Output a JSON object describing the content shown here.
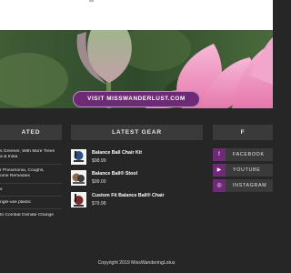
{
  "hero": {
    "button_label": "VISIT MISSWANDERLUST.COM"
  },
  "related": {
    "heading": "ATED",
    "items": [
      "s Greener, With More Trees",
      "a & India",
      "r Pneumonia, Coughs,",
      "ome Remedies",
      "s",
      "ngle-use plastic",
      "to Combat Climate Change"
    ]
  },
  "latest_gear": {
    "heading": "LATEST GEAR",
    "items": [
      {
        "name": "Balance Ball Chair Kit",
        "price": "$98.99"
      },
      {
        "name": "Balance Ball® Stool",
        "price": "$99.00"
      },
      {
        "name": "Custom Fit Balance Ball® Chair",
        "price": "$79.98"
      }
    ]
  },
  "social": {
    "heading": "F",
    "links": [
      {
        "label": "FACEBOOK",
        "icon": "facebook-icon"
      },
      {
        "label": "YOUTUBE",
        "icon": "youtube-icon"
      },
      {
        "label": "INSTAGRAM",
        "icon": "instagram-icon"
      }
    ]
  },
  "footer": {
    "copyright": "Copyright 2019 MissWanderingLotus"
  },
  "colors": {
    "accent": "#6f2a77",
    "background": "#262626",
    "panel": "#3a3a3a"
  }
}
